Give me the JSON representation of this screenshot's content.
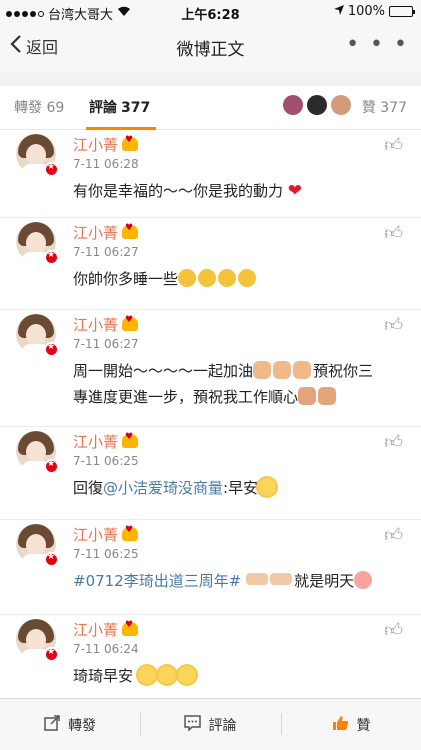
{
  "status_bar": {
    "carrier": "台湾大哥大",
    "time": "上午6:28",
    "battery": "100%"
  },
  "nav": {
    "back_label": "返回",
    "title": "微博正文",
    "more_label": "• • •"
  },
  "tabs": {
    "repost_label": "轉發",
    "repost_count": "69",
    "comment_label": "評論",
    "comment_count": "377",
    "like_label": "贊",
    "like_count": "377"
  },
  "comments": [
    {
      "user": "江小菁",
      "time": "7-11 06:28",
      "text": "有你是幸福的～～你是我的動力",
      "emojis": [
        "heart"
      ]
    },
    {
      "user": "江小菁",
      "time": "7-11 06:27",
      "text": "你帥你多睡一些",
      "emojis": [
        "grin",
        "grin",
        "grin",
        "grin"
      ]
    },
    {
      "user": "江小菁",
      "time": "7-11 06:27",
      "text_line1": "周一開始～～～～一起加油",
      "text_line2": "專進度更進一步，預祝我工作順心",
      "line1_suffix": "預祝你三"
    },
    {
      "user": "江小菁",
      "time": "7-11 06:25",
      "prefix": "回復",
      "mention": "@小洁爱琦没商量",
      "suffix": ":早安"
    },
    {
      "user": "江小菁",
      "time": "7-11 06:25",
      "hashtag": "#0712李琦出道三周年#",
      "suffix": "就是明天"
    },
    {
      "user": "江小菁",
      "time": "7-11 06:24",
      "text": "琦琦早安"
    }
  ],
  "toolbar": {
    "repost_label": "轉發",
    "comment_label": "評論",
    "like_label": "贊"
  },
  "icons": {
    "like": "thumbs-up-icon",
    "back": "chevron-left-icon",
    "repost": "share-icon",
    "comment": "comment-icon"
  },
  "colors": {
    "accent": "#ff8200",
    "username": "#eb7350",
    "link": "#4a7aa9"
  }
}
